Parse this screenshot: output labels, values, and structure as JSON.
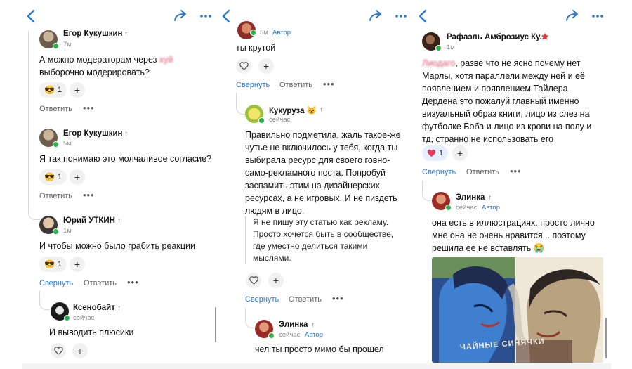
{
  "colors": {
    "accent": "#2a78d6",
    "online": "#2bb24c",
    "star": "#e23b3b",
    "heart": "#e8395c"
  },
  "icons": {
    "back": "chevron-left-icon",
    "share": "share-arrow-icon",
    "more": "more-dots-icon",
    "like": "heart-outline-icon",
    "add": "plus-icon",
    "expand": "upvote-arrow-icon"
  },
  "panel1": {
    "comments": [
      {
        "author": "Егор Кукушкин",
        "time": "7м",
        "text_a": "А можно модераторам через ",
        "text_blur": "хуй",
        "text_b": "выборочно модерировать?",
        "reaction": "😎",
        "count": "1",
        "reply": "Ответить"
      },
      {
        "author": "Егор Кукушкин",
        "time": "5м",
        "text": "Я так понимаю это молчаливое согласие?",
        "reaction": "😎",
        "count": "1",
        "reply": "Ответить"
      },
      {
        "author": "Юрий УТКИН",
        "time": "1м",
        "text": "И чтобы можно было грабить реакции",
        "reaction": "😎",
        "count": "1",
        "collapse": "Свернуть",
        "reply": "Ответить"
      },
      {
        "author": "Ксенобайт",
        "time": "сейчас",
        "text": "И выводить плюсики"
      }
    ]
  },
  "panel2": {
    "top": {
      "time": "5м",
      "badge": "Автор",
      "text": "ты крутой",
      "collapse": "Свернуть",
      "reply": "Ответить"
    },
    "kukuruza": {
      "author": "Кукуруза",
      "author_emoji": "😼",
      "time": "сейчас",
      "text": "Правильно подметила, жаль такое-же чутье не включилось у тебя, когда ты выбирала ресурс для своего говно-само-рекламного поста. Попробуй заспамить этим на дизайнерских ресурсах, а не игровых. И не пиздеть людям в лицо.",
      "quote": "Я не пишу эту статью как рекламу. Просто хочется быть в сообществе, где уместно делиться такими мыслями.",
      "collapse": "Свернуть",
      "reply": "Ответить"
    },
    "elinka": {
      "author": "Элинка",
      "time": "сейчас",
      "badge": "Автор",
      "text": "чел ты просто мимо бы прошел"
    }
  },
  "panel3": {
    "rafael": {
      "author": "Рафаэль Амброзиус Ку...",
      "time": "1м",
      "text_blur": "Лиодаго",
      "text": ", разве что не ясно почему нет Марлы, хотя параллели между ней и её появлением и появлением Тайлера Дёрдена это пожалуй главный именно визуальный образ книги, лицо из слез на футболке Боба и лицо из крови на полу и тд, странно не использовать его",
      "count": "1",
      "collapse": "Свернуть",
      "reply": "Ответить"
    },
    "elinka": {
      "author": "Элинка",
      "time": "сейчас",
      "badge": "Автор",
      "text": "она есть в иллюстрациях. просто лично мне она не очень нравится... поэтому решила ее не вставлять 😭"
    },
    "image_caption": "ЧАЙНЫЕ СИНЯЧКИ"
  }
}
